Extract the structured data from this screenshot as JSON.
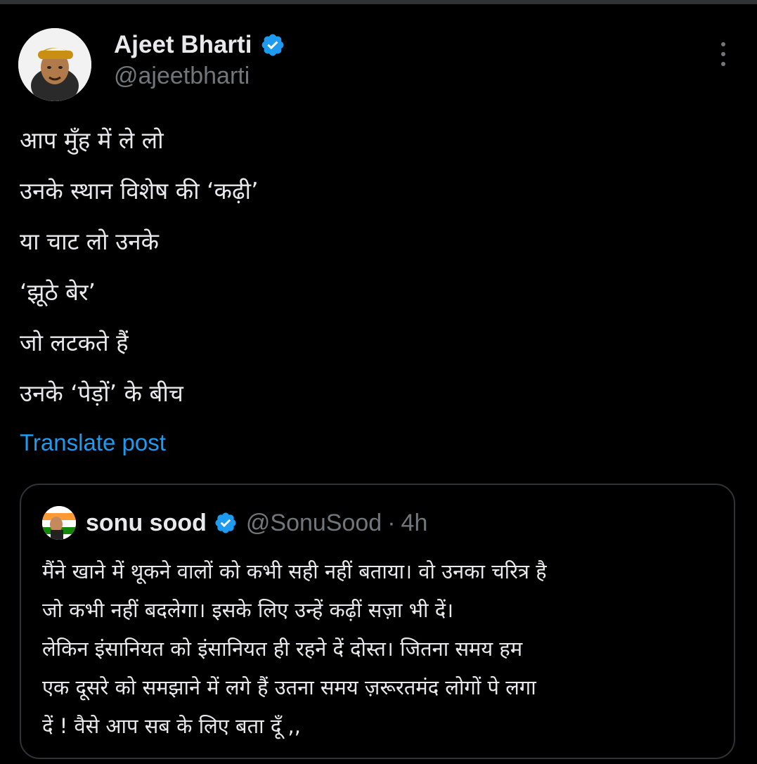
{
  "post": {
    "author": {
      "display_name": "Ajeet Bharti",
      "handle": "@ajeetbharti",
      "verified_icon": "verified-badge-icon"
    },
    "body_lines": [
      "आप मुँह में ले लो",
      "उनके स्थान विशेष की ‘कढ़ी’",
      "या चाट लो उनके",
      "‘झूठे बेर’",
      "जो लटकते हैं",
      "उनके ‘पेड़ों’ के बीच"
    ],
    "translate_label": "Translate post"
  },
  "quoted_post": {
    "author": {
      "display_name": "sonu sood",
      "handle": "@SonuSood",
      "separator": "·",
      "time": "4h"
    },
    "body_lines": [
      "मैंने खाने में थूकने वालों को कभी सही नहीं बताया। वो उनका चरित्र है",
      "जो कभी नहीं बदलेगा। इसके लिए उन्हें कढ़ीं सज़ा भी दें।",
      "लेकिन इंसानियत को इंसानियत ही रहने दें दोस्त। जितना समय हम",
      "एक दूसरे को समझाने में लगे हैं उतना समय ज़रूरतमंद लोगों पे लगा",
      "दें ! वैसे आप सब के लिए बता दूँ ,,"
    ]
  },
  "colors": {
    "background": "#000000",
    "text": "#e7e9ea",
    "secondary_text": "#71767b",
    "accent": "#1d9bf0",
    "border": "#2f3336"
  },
  "icons": [
    "verified-badge-icon",
    "more-options-icon",
    "avatar",
    "quoted-avatar"
  ]
}
